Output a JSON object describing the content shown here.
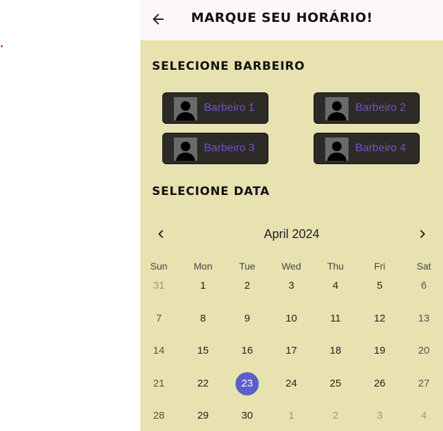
{
  "header": {
    "title": "Marque seu horário!"
  },
  "sections": {
    "barber_title": "Selecione barbeiro",
    "date_title": "Selecione data"
  },
  "barbers": [
    "Barbeiro 1",
    "Barbeiro 2",
    "Barbeiro 3",
    "Barbeiro 4"
  ],
  "calendar": {
    "month_label": "April 2024",
    "weekdays": [
      "Sun",
      "Mon",
      "Tue",
      "Wed",
      "Thu",
      "Fri",
      "Sat"
    ],
    "weeks": [
      [
        "31",
        "1",
        "2",
        "3",
        "4",
        "5",
        "6"
      ],
      [
        "7",
        "8",
        "9",
        "10",
        "11",
        "12",
        "13"
      ],
      [
        "14",
        "15",
        "16",
        "17",
        "18",
        "19",
        "20"
      ],
      [
        "21",
        "22",
        "23",
        "24",
        "25",
        "26",
        "27"
      ],
      [
        "28",
        "29",
        "30",
        "1",
        "2",
        "3",
        "4"
      ]
    ],
    "selected_day": "23"
  },
  "colors": {
    "panel_bg": "#e8e2b1",
    "selected": "#5b5fc7",
    "barber_label": "#6f56c4"
  }
}
